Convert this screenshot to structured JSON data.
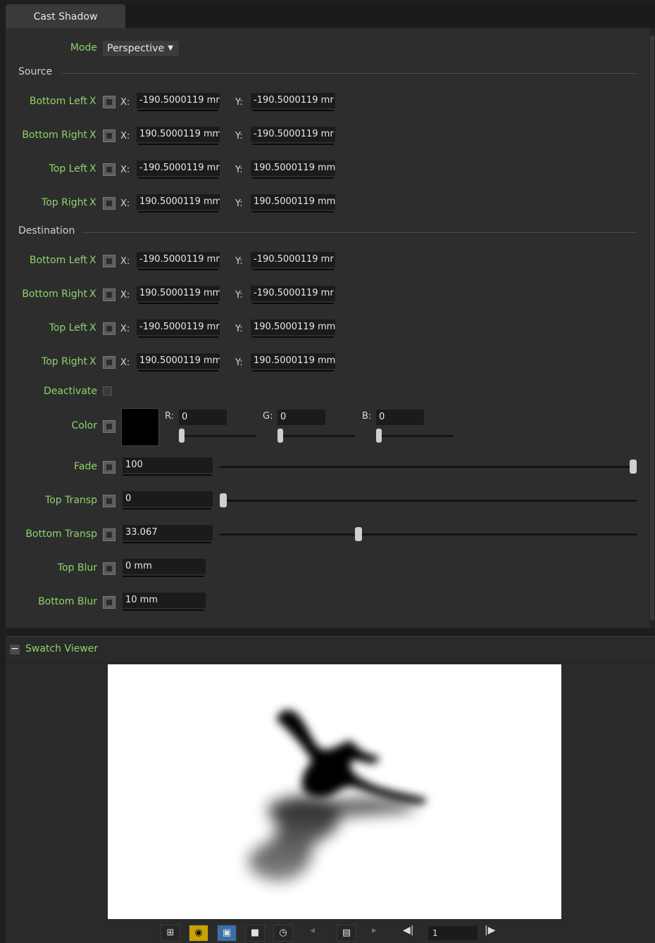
{
  "tab": {
    "title": "Cast Shadow"
  },
  "mode": {
    "label": "Mode",
    "value": "Perspective"
  },
  "source": {
    "title": "Source",
    "rows": [
      {
        "label": "Bottom Left",
        "x": "-190.5000119 mr",
        "y": "-190.5000119 mr"
      },
      {
        "label": "Bottom Right",
        "x": "190.5000119 mm",
        "y": "-190.5000119 mr"
      },
      {
        "label": "Top Left",
        "x": "-190.5000119 mr",
        "y": "190.5000119 mm"
      },
      {
        "label": "Top Right",
        "x": "190.5000119 mm",
        "y": "190.5000119 mm"
      }
    ]
  },
  "destination": {
    "title": "Destination",
    "rows": [
      {
        "label": "Bottom Left",
        "x": "-190.5000119 mr",
        "y": "-190.5000119 mr"
      },
      {
        "label": "Bottom Right",
        "x": "190.5000119 mm",
        "y": "-190.5000119 mr"
      },
      {
        "label": "Top Left",
        "x": "-190.5000119 mr",
        "y": "190.5000119 mm"
      },
      {
        "label": "Top Right",
        "x": "190.5000119 mm",
        "y": "190.5000119 mm"
      }
    ]
  },
  "axis": {
    "x_marker": "X",
    "x": "X:",
    "y": "Y:"
  },
  "deactivate": {
    "label": "Deactivate",
    "checked": false
  },
  "color": {
    "label": "Color",
    "swatch": "#000000",
    "r_label": "R:",
    "r": "0",
    "g_label": "G:",
    "g": "0",
    "b_label": "B:",
    "b": "0"
  },
  "fade": {
    "label": "Fade",
    "value": "100",
    "slider_fraction": 1.0
  },
  "top_transp": {
    "label": "Top Transp",
    "value": "0",
    "slider_fraction": 0.0
  },
  "bottom_transp": {
    "label": "Bottom Transp",
    "value": "33.067",
    "slider_fraction": 0.33067
  },
  "top_blur": {
    "label": "Top Blur",
    "value": "0 mm"
  },
  "bottom_blur": {
    "label": "Bottom Blur",
    "value": "10 mm"
  },
  "swatch_viewer": {
    "title": "Swatch Viewer",
    "minus": "−"
  },
  "toolbar": {
    "frame": "1"
  },
  "colors": {
    "accent_label": "#8fd36b",
    "panel_bg": "#2d2d2d",
    "active": "#3a6fa8",
    "yellow": "#caa300"
  }
}
